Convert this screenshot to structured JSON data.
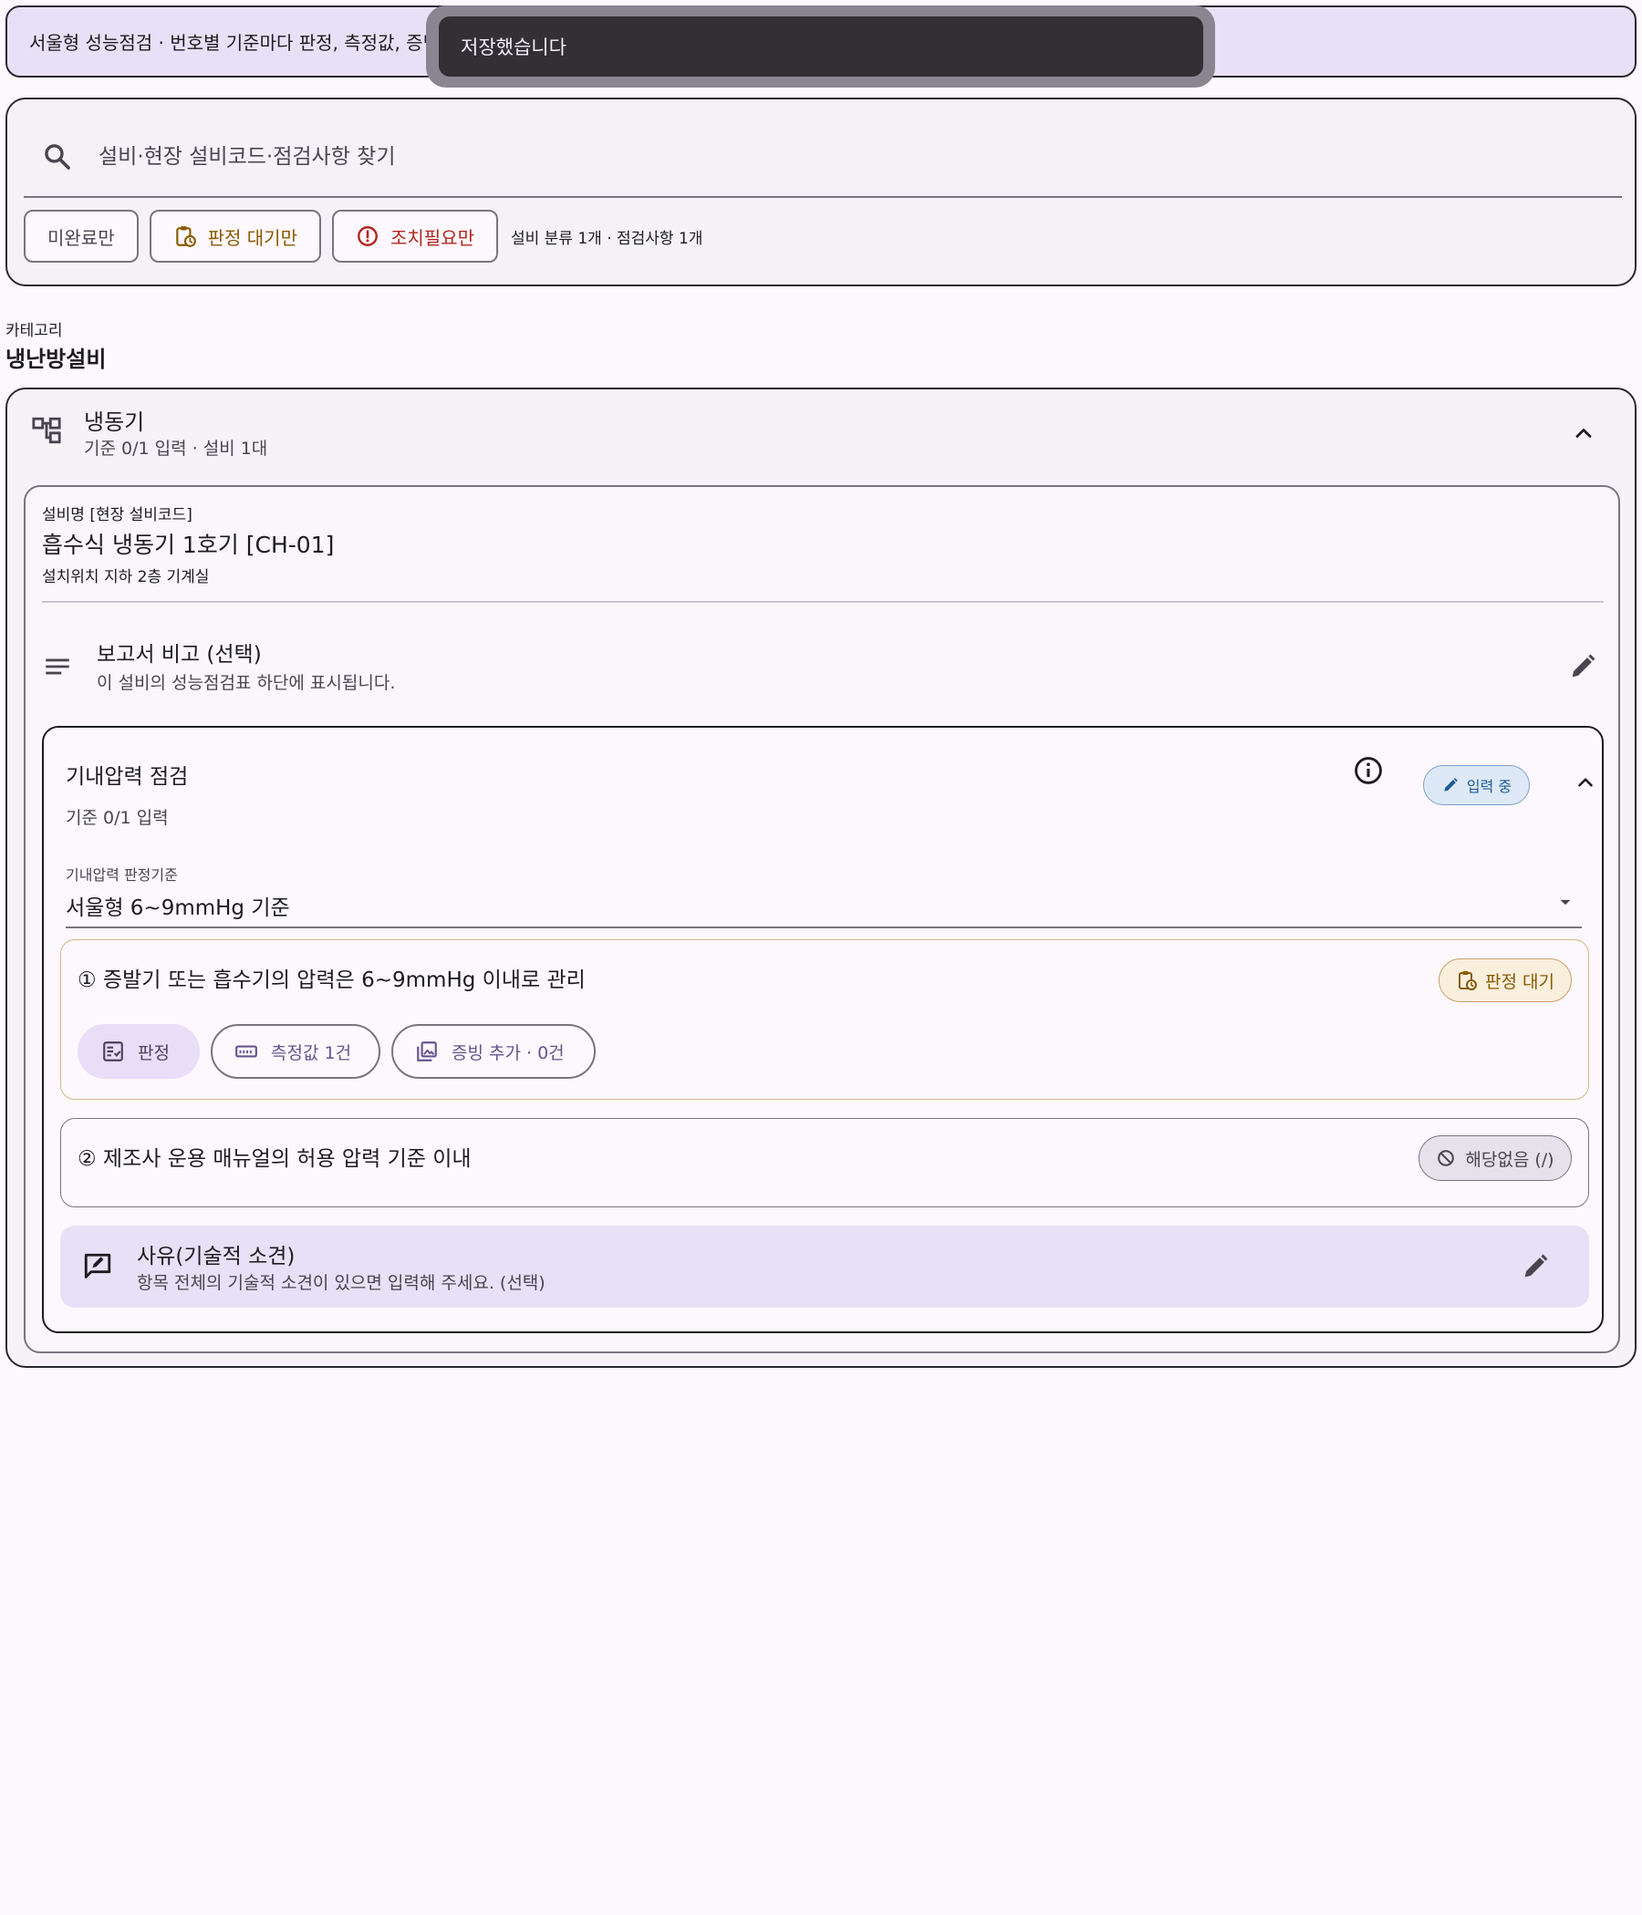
{
  "banner": {
    "text": "서울형 성능점검 · 번호별 기준마다 판정, 측정값, 증빙"
  },
  "snackbar": {
    "message": "저장했습니다"
  },
  "search": {
    "placeholder": "설비·현장 설비코드·점검사항 찾기"
  },
  "filters": {
    "incomplete": "미완료만",
    "pending": "판정 대기만",
    "action_needed": "조치필요만",
    "count_text": "설비 분류 1개 · 점검사항 1개"
  },
  "category": {
    "label": "카테고리",
    "value": "냉난방설비"
  },
  "group": {
    "title": "냉동기",
    "subtitle": "기준 0/1 입력 · 설비 1대"
  },
  "equipment": {
    "label": "설비명 [현장 설비코드]",
    "name": "흡수식 냉동기 1호기 [CH-01]",
    "location": "설치위치 지하 2층 기계실",
    "remark_title": "보고서 비고 (선택)",
    "remark_sub": "이 설비의 성능점검표 하단에 표시됩니다."
  },
  "item": {
    "title": "기내압력 점검",
    "subtitle": "기준 0/1 입력",
    "status": "입력 중",
    "criteria_dropdown": {
      "label": "기내압력 판정기준",
      "value": "서울형 6~9mmHg 기준"
    },
    "criteria": [
      {
        "text": "① 증발기 또는 흡수기의 압력은 6~9mmHg 이내로 관리",
        "status": "판정 대기",
        "actions": {
          "judge": "판정",
          "measure": "측정값 1건",
          "evidence": "증빙 추가 · 0건"
        }
      },
      {
        "text": "② 제조사 운용 매뉴얼의 허용 압력 기준 이내",
        "status": "해당없음 (/)"
      }
    ],
    "reason": {
      "title": "사유(기술적 소견)",
      "subtitle": "항목 전체의 기술적 소견이 있으면 입력해 주세요. (선택)"
    }
  },
  "colors": {
    "accent": "#65558f",
    "pending": "#8a5a00",
    "action_needed": "#b3261e",
    "in_progress": "#1f5b96"
  },
  "icons": [
    "search-icon",
    "clipboard-clock-icon",
    "alert-circle-icon",
    "tree-icon",
    "chevron-up-icon",
    "lines-icon",
    "pencil-icon",
    "info-icon",
    "caret-down-icon",
    "checklist-icon",
    "ruler-icon",
    "image-stack-icon",
    "block-icon",
    "feedback-icon"
  ]
}
